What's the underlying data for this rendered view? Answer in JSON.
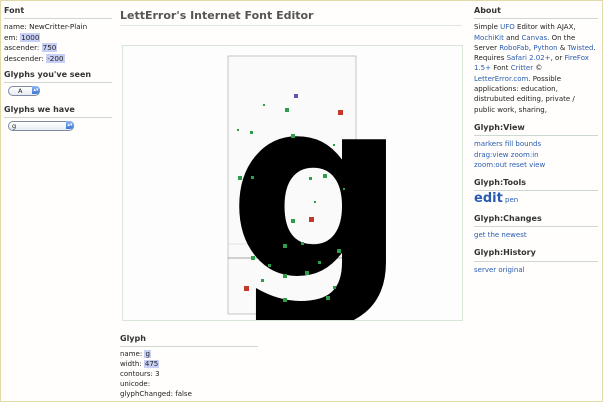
{
  "left": {
    "font_heading": "Font",
    "name_label": "name:",
    "name_value": "NewCritter-Plain",
    "em_label": "em:",
    "em_value": "1000",
    "ascender_label": "ascender:",
    "ascender_value": "750",
    "descender_label": "descender:",
    "descender_value": "-200",
    "seen_heading": "Glyphs you've seen",
    "seen_select_value": "A",
    "have_heading": "Glyphs we have",
    "have_select_value": "g"
  },
  "header": {
    "title": "LettError's Internet Font Editor"
  },
  "editor": {
    "glyph_char": "g"
  },
  "glyph": {
    "heading": "Glyph",
    "name_label": "name:",
    "name_value": "g",
    "width_label": "width:",
    "width_value": "475",
    "contours_line": "contours: 3",
    "unicode_line": "unicode:",
    "changed_line": "glyphChanged: false"
  },
  "about": {
    "heading": "About",
    "t1": "Simple ",
    "ufo": "UFO",
    "t2": " Editor with AJAX, ",
    "mochikit": "MochiKit",
    "t3": " and ",
    "canvas": "Canvas",
    "t4": ". On the Server ",
    "robofab": "RoboFab",
    "t5": ", ",
    "python": "Python",
    "t6": " & ",
    "twisted": "Twisted",
    "t7": ". Requires ",
    "safari": "Safari 2.02+",
    "t8": ", or ",
    "firefox": "FireFox 1.5+",
    "t9": " Font ",
    "critter": "Critter",
    "t10": " © ",
    "letterror": "LetterError.com",
    "t11": ". Possible applications: education, distrubuted editing, private / public work, sharing,"
  },
  "view": {
    "heading": "Glyph:View",
    "markers": "markers",
    "fill": "fill",
    "bounds": "bounds",
    "drag_view": "drag:view",
    "zoom_in": "zoom:in",
    "zoom_out": "zoom:out",
    "reset": "reset",
    "view": "view"
  },
  "tools": {
    "heading": "Glyph:Tools",
    "edit": "edit",
    "pen": "pen"
  },
  "changes": {
    "heading": "Glyph:Changes",
    "get_newest": "get the newest"
  },
  "history": {
    "heading": "Glyph:History",
    "server_original": "server original"
  }
}
